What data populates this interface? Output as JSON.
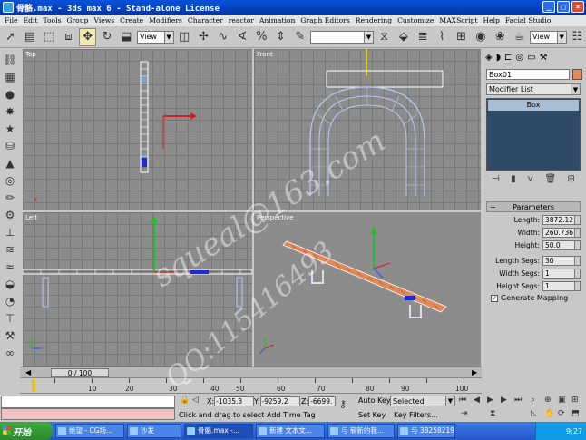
{
  "window": {
    "title": "骨骼.max - 3ds max 6 - Stand-alone License"
  },
  "menu": [
    "File",
    "Edit",
    "Tools",
    "Group",
    "Views",
    "Create",
    "Modifiers",
    "Character",
    "reactor",
    "Animation",
    "Graph Editors",
    "Rendering",
    "Customize",
    "MAXScript",
    "Help",
    "Facial Studio"
  ],
  "toolbar": {
    "refcoord": "View",
    "refcoord2": "View",
    "named_sel": ""
  },
  "viewports": {
    "top": "Top",
    "front": "Front",
    "left": "Left",
    "perspective": "Perspective"
  },
  "command_panel": {
    "object_name": "Box01",
    "object_color": "#e0895a",
    "modifier_list": "Modifier List",
    "stack_item": "Box",
    "rollout": "Parameters",
    "params": [
      {
        "label": "Length:",
        "value": "3872.12"
      },
      {
        "label": "Width:",
        "value": "260.736"
      },
      {
        "label": "Height:",
        "value": "50.0"
      },
      {
        "label": "Length Segs:",
        "value": "30"
      },
      {
        "label": "Width Segs:",
        "value": "1"
      },
      {
        "label": "Height Segs:",
        "value": "1"
      }
    ],
    "generate_mapping": "Generate Mapping"
  },
  "timeline": {
    "frame": "0 / 100",
    "ticks": [
      "10",
      "20",
      "30",
      "40",
      "50",
      "60",
      "70",
      "80",
      "90",
      "100"
    ]
  },
  "status": {
    "x_label": "X:",
    "x_value": "-1035.3",
    "y_label": "Y:",
    "y_value": "-9259.2",
    "z_label": "Z:",
    "z_value": "-6699.",
    "prompt": "Click and drag to select",
    "add_time_tag": "Add Time Tag",
    "auto_key": "Auto Key",
    "set_key": "Set Key",
    "key_filters": "Key Filters...",
    "selected": "Selected"
  },
  "taskbar": {
    "start": "开始",
    "tasks": [
      "绝望 - CG场...",
      "沙发",
      "骨骼.max -...",
      "新建 文本文...",
      "与 崭新的我...",
      "与 38258219..."
    ],
    "clock": "9:27"
  },
  "watermark": {
    "line1": "squeal@163.com",
    "line2": "QQ:115416493"
  }
}
